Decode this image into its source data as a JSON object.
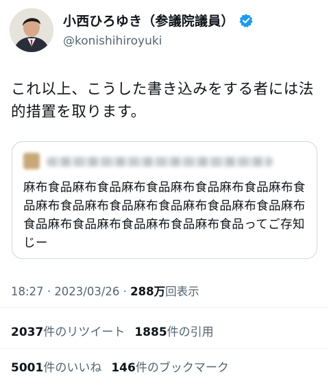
{
  "author": {
    "display_name": "小西ひろゆき（参議院議員）",
    "handle": "@konishihiroyuki",
    "verified_color": "#1d9bf0",
    "icons": {
      "verified": "verified-badge-icon"
    }
  },
  "tweet": {
    "text": "これ以上、こうした書き込みをする者には法的措置を取ります。"
  },
  "quote": {
    "text": "麻布食品麻布食品麻布食品麻布食品麻布食品麻布食品麻布食品麻布食品麻布食品麻布食品麻布食品麻布食品麻布食品麻布食品麻布食品麻布食品ってご存知じー"
  },
  "meta": {
    "time": "18:27",
    "separator": "·",
    "date": "2023/03/26",
    "separator2": "·",
    "views_count": "288万",
    "views_label": "回表示"
  },
  "stats": {
    "retweets_count": "2037",
    "retweets_label": "件のリツイート",
    "quotes_count": "1885",
    "quotes_label": "件の引用",
    "likes_count": "5001",
    "likes_label": "件のいいね",
    "bookmarks_count": "146",
    "bookmarks_label": "件のブックマーク"
  }
}
